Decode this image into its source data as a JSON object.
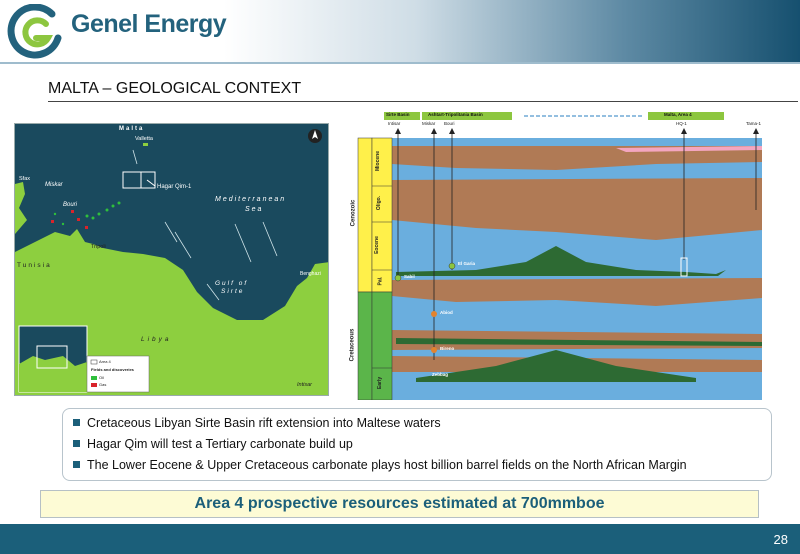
{
  "header": {
    "company_name": "Genel Energy",
    "colors": {
      "brand_teal": "#23627d",
      "brand_green": "#8dc63f",
      "footer": "#1b5f7a"
    }
  },
  "slide": {
    "title": "MALTA – GEOLOGICAL CONTEXT",
    "page_number": "28"
  },
  "map": {
    "labels": {
      "malta": "Malta",
      "valletta": "Valletta",
      "hagar_qim": "Hagar Qim-1",
      "sfax": "Sfax",
      "miskar": "Miskar",
      "bouri": "Bouri",
      "tripoli": "Tripoli",
      "tunisia": "Tunisia",
      "mediterranean": "Mediterranean",
      "sea": "Sea",
      "gulf_of": "Gulf of",
      "sirte": "Sirte",
      "libya": "Libya",
      "benghazi": "Benghazi",
      "intisar": "Intisar"
    },
    "legend": {
      "area4": "Area 4",
      "fields_title": "Fields and discoveries",
      "oil": "Oil",
      "gas": "Gas"
    },
    "colors": {
      "sea": "#1a4a5e",
      "land": "#8dcf3f",
      "oil": "#2fbf3c",
      "gas": "#d9232a"
    }
  },
  "section": {
    "basins": {
      "sirte": "Sirte Basin",
      "ashtart": "Ashtart-Tripolitania Basin",
      "malta": "Malta, Area 4"
    },
    "wells": {
      "intisar": "Intisar",
      "miskar": "Miskar",
      "bouri": "Bouri",
      "hq1": "HQ-1",
      "tama1": "Tama-1"
    },
    "eras": {
      "cenozoic": "Cenozoic",
      "cretaceous": "Cretaceous"
    },
    "epochs": {
      "miocene": "Miocene",
      "oligo": "Oligo.",
      "eocene": "Eocene",
      "pal": "Pal.",
      "early": "Early"
    },
    "fields": {
      "sabil": "Sabil",
      "el_garia": "El Garia",
      "abiod": "Abiod",
      "bireno": "Bireno",
      "zebbag": "Zebbag"
    },
    "colors": {
      "shale": "#b07a55",
      "carbonate": "#6aaede",
      "reef": "#2d6a33",
      "era_band": "#fff04a",
      "cret_band": "#5bb54a"
    }
  },
  "bullets": [
    "Cretaceous Libyan Sirte Basin rift extension into Maltese waters",
    "Hagar Qim will test a Tertiary carbonate build up",
    "The Lower Eocene & Upper Cretaceous carbonate plays host billion barrel fields on the North African Margin"
  ],
  "callout": "Area 4 prospective resources estimated at 700mmboe"
}
